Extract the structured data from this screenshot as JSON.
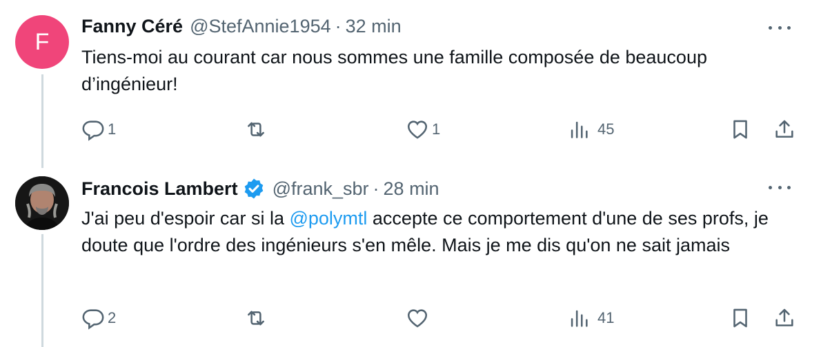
{
  "tweets": [
    {
      "avatar_letter": "F",
      "avatar_color": "#f0457a",
      "name": "Fanny Céré",
      "handle": "@StefAnnie1954",
      "separator": "·",
      "time": "32 min",
      "text": "Tiens-moi au courant car nous sommes une famille composée de beaucoup d’ingénieur!",
      "replies": "1",
      "retweets": "",
      "likes": "1",
      "views": "45"
    },
    {
      "avatar_letter": "",
      "name": "Francois Lambert",
      "verified": true,
      "handle": "@frank_sbr",
      "separator": "·",
      "time": "28 min",
      "text_before": "J'ai peu d'espoir car si la ",
      "mention": "@polymtl",
      "text_after": " accepte ce comportement d'une de ses profs, je doute que l'ordre des ingénieurs s'en mêle. Mais je me dis qu'on ne sait jamais",
      "replies": "2",
      "retweets": "",
      "likes": "",
      "views": "41"
    }
  ],
  "colors": {
    "text_primary": "#0f1419",
    "text_secondary": "#536471",
    "link": "#1d9bf0",
    "verified": "#1d9bf0",
    "thread_line": "#cfd9de"
  },
  "icons": [
    "reply-icon",
    "retweet-icon",
    "like-icon",
    "views-icon",
    "bookmark-icon",
    "share-icon",
    "more-icon",
    "verified-badge-icon"
  ]
}
